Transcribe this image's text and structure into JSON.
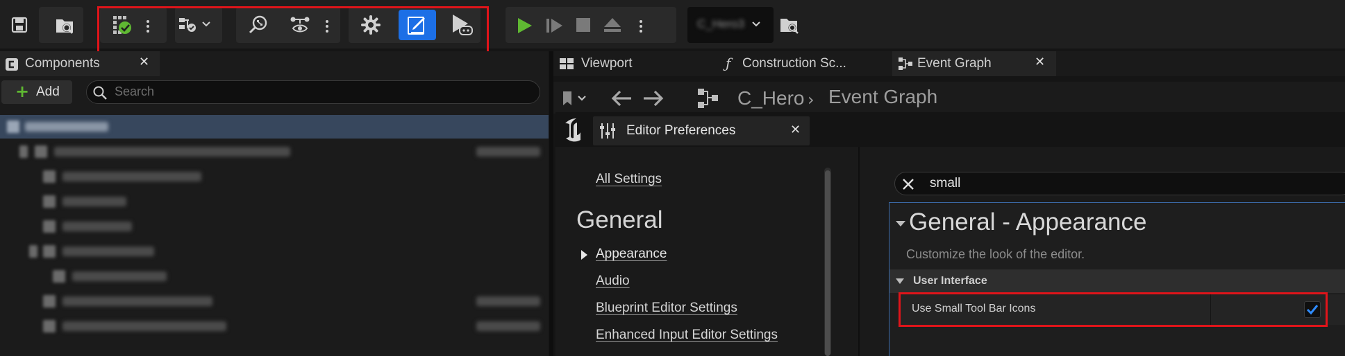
{
  "toolbar": {
    "icons": [
      "save-icon",
      "browse-icon",
      "compile-icon",
      "diff-icon",
      "find-icon",
      "hide-unrelated-icon",
      "class-settings-icon",
      "class-defaults-icon",
      "simulation-icon",
      "play-icon",
      "step-icon",
      "stop-icon",
      "eject-icon"
    ],
    "debug_object": "C_Hero3",
    "accent_color": "#1c6fe6",
    "highlight_color": "#e0141a",
    "play_color": "#5fb832"
  },
  "components": {
    "tab_label": "Components",
    "add_label": "Add",
    "search_placeholder": "Search"
  },
  "editor_tabs": [
    {
      "label": "Viewport"
    },
    {
      "label": "Construction Sc..."
    },
    {
      "label": "Event Graph"
    }
  ],
  "breadcrumb": {
    "root": "C_Hero",
    "current": "Event Graph"
  },
  "prefs": {
    "tab_label": "Editor Preferences",
    "all_settings": "All Settings",
    "section_title": "General",
    "nav_items": [
      "Appearance",
      "Audio",
      "Blueprint Editor Settings",
      "Enhanced Input Editor Settings"
    ],
    "search_value": "small",
    "category_title": "General - Appearance",
    "category_desc": "Customize the look of the editor.",
    "subcategory": "User Interface",
    "setting_label": "Use Small Tool Bar Icons",
    "setting_checked": true
  }
}
